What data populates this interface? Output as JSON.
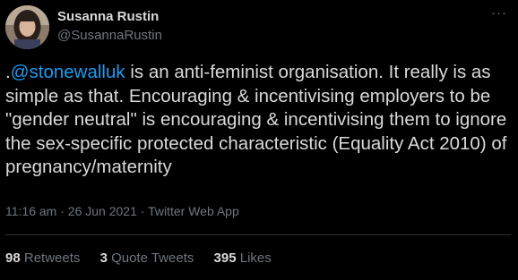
{
  "author": {
    "name": "Susanna Rustin",
    "handle": "@SusannaRustin",
    "avatar_icon": "profile-photo"
  },
  "more_menu": {
    "glyph": "···"
  },
  "tweet": {
    "prefix": ".",
    "mention": "@stonewalluk",
    "body": " is an anti-feminist organisation. It really is as simple as that. Encouraging & incentivising employers to be \"gender neutral\" is encouraging & incentivising them to ignore the sex-specific protected characteristic (Equality Act 2010) of pregnancy/maternity"
  },
  "meta": {
    "time": "11:16 am",
    "sep1": " · ",
    "date": "26 Jun 2021",
    "sep2": " · ",
    "source": "Twitter Web App"
  },
  "stats": {
    "retweets": {
      "count": "98",
      "label": "Retweets"
    },
    "quotes": {
      "count": "3",
      "label": "Quote Tweets"
    },
    "likes": {
      "count": "395",
      "label": "Likes"
    }
  },
  "colors": {
    "background": "#000000",
    "text": "#d9d9d9",
    "secondary": "#6e767d",
    "link": "#1d9bf0",
    "divider": "#2f3336"
  }
}
